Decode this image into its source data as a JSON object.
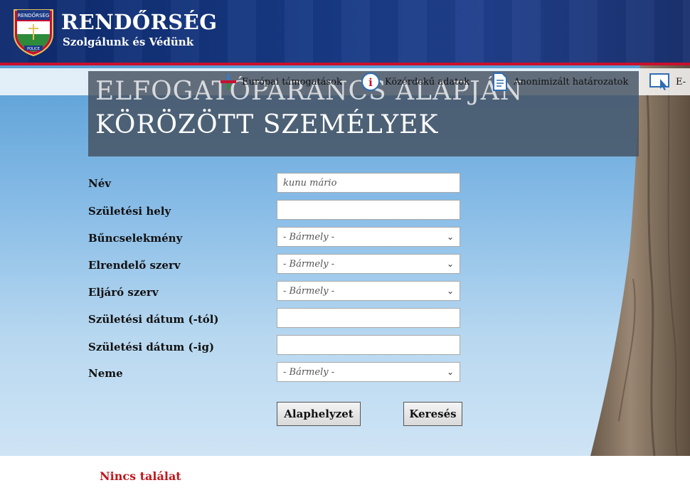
{
  "header": {
    "title": "RENDŐRSÉG",
    "subtitle": "Szolgálunk és Védünk",
    "logo_text": "RENDŐRSÉG",
    "logo_badge": "POLICE"
  },
  "nav": {
    "items": [
      {
        "label": "Európai támogatások",
        "icon": "eu-support-icon"
      },
      {
        "label": "Közérdekű adatok",
        "icon": "info-icon"
      },
      {
        "label": "Anonimizált határozatok",
        "icon": "document-icon"
      },
      {
        "label": "E-",
        "icon": "e-service-icon"
      }
    ]
  },
  "page": {
    "title_line1": "ELFOGATÓPARANCS ALAPJÁN",
    "title_line2": "KÖRÖZÖTT SZEMÉLYEK"
  },
  "form": {
    "name": {
      "label": "Név",
      "value": "kunu mário"
    },
    "birth_place": {
      "label": "Születési hely",
      "value": ""
    },
    "crime": {
      "label": "Bűncselekmény",
      "value": "- Bármely -"
    },
    "ordering_body": {
      "label": "Elrendelő szerv",
      "value": "- Bármely -"
    },
    "acting_body": {
      "label": "Eljáró szerv",
      "value": "- Bármely -"
    },
    "birth_from": {
      "label": "Születési dátum (-tól)",
      "value": ""
    },
    "birth_to": {
      "label": "Születési dátum (-ig)",
      "value": ""
    },
    "gender": {
      "label": "Neme",
      "value": "- Bármely -"
    },
    "reset_label": "Alaphelyzet",
    "search_label": "Keresés"
  },
  "result": {
    "text": "Nincs találat"
  },
  "colors": {
    "header": "#173a85",
    "accent_red": "#c8102e",
    "result_red": "#c0171c"
  }
}
